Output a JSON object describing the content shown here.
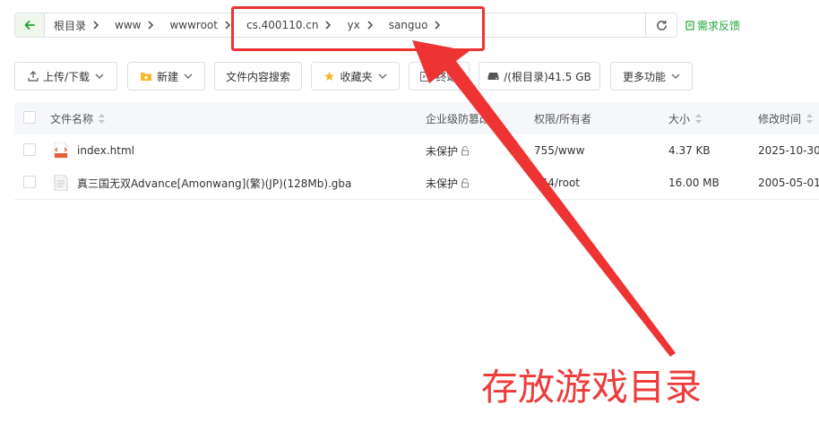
{
  "breadcrumb": {
    "items": [
      "根目录",
      "www",
      "wwwroot",
      "cs.400110.cn",
      "yx",
      "sanguo"
    ]
  },
  "feedback_label": "需求反馈",
  "toolbar": {
    "upload_label": "上传/下载",
    "new_label": "新建",
    "search_label": "文件内容搜索",
    "favorites_label": "收藏夹",
    "terminal_label": "终端",
    "disk_label": "/(根目录)41.5 GB",
    "more_label": "更多功能"
  },
  "table": {
    "columns": {
      "name": "文件名称",
      "protect": "企业级防篡改",
      "perm": "权限/所有者",
      "size": "大小",
      "mtime": "修改时间"
    },
    "rows": [
      {
        "name": "index.html",
        "protect": "未保护",
        "perm": "755/www",
        "size": "4.37 KB",
        "mtime": "2025-10-30",
        "icon": "html-file-icon"
      },
      {
        "name": "真三国无双Advance[Amonwang](繁)(JP)(128Mb).gba",
        "protect": "未保护",
        "perm": "644/root",
        "size": "16.00 MB",
        "mtime": "2005-05-01",
        "icon": "generic-file-icon"
      }
    ]
  },
  "annotation": {
    "text": "存放游戏目录",
    "color": "#ee3b3b"
  },
  "colors": {
    "accent": "#20a53a",
    "annotation": "#ee3333"
  }
}
